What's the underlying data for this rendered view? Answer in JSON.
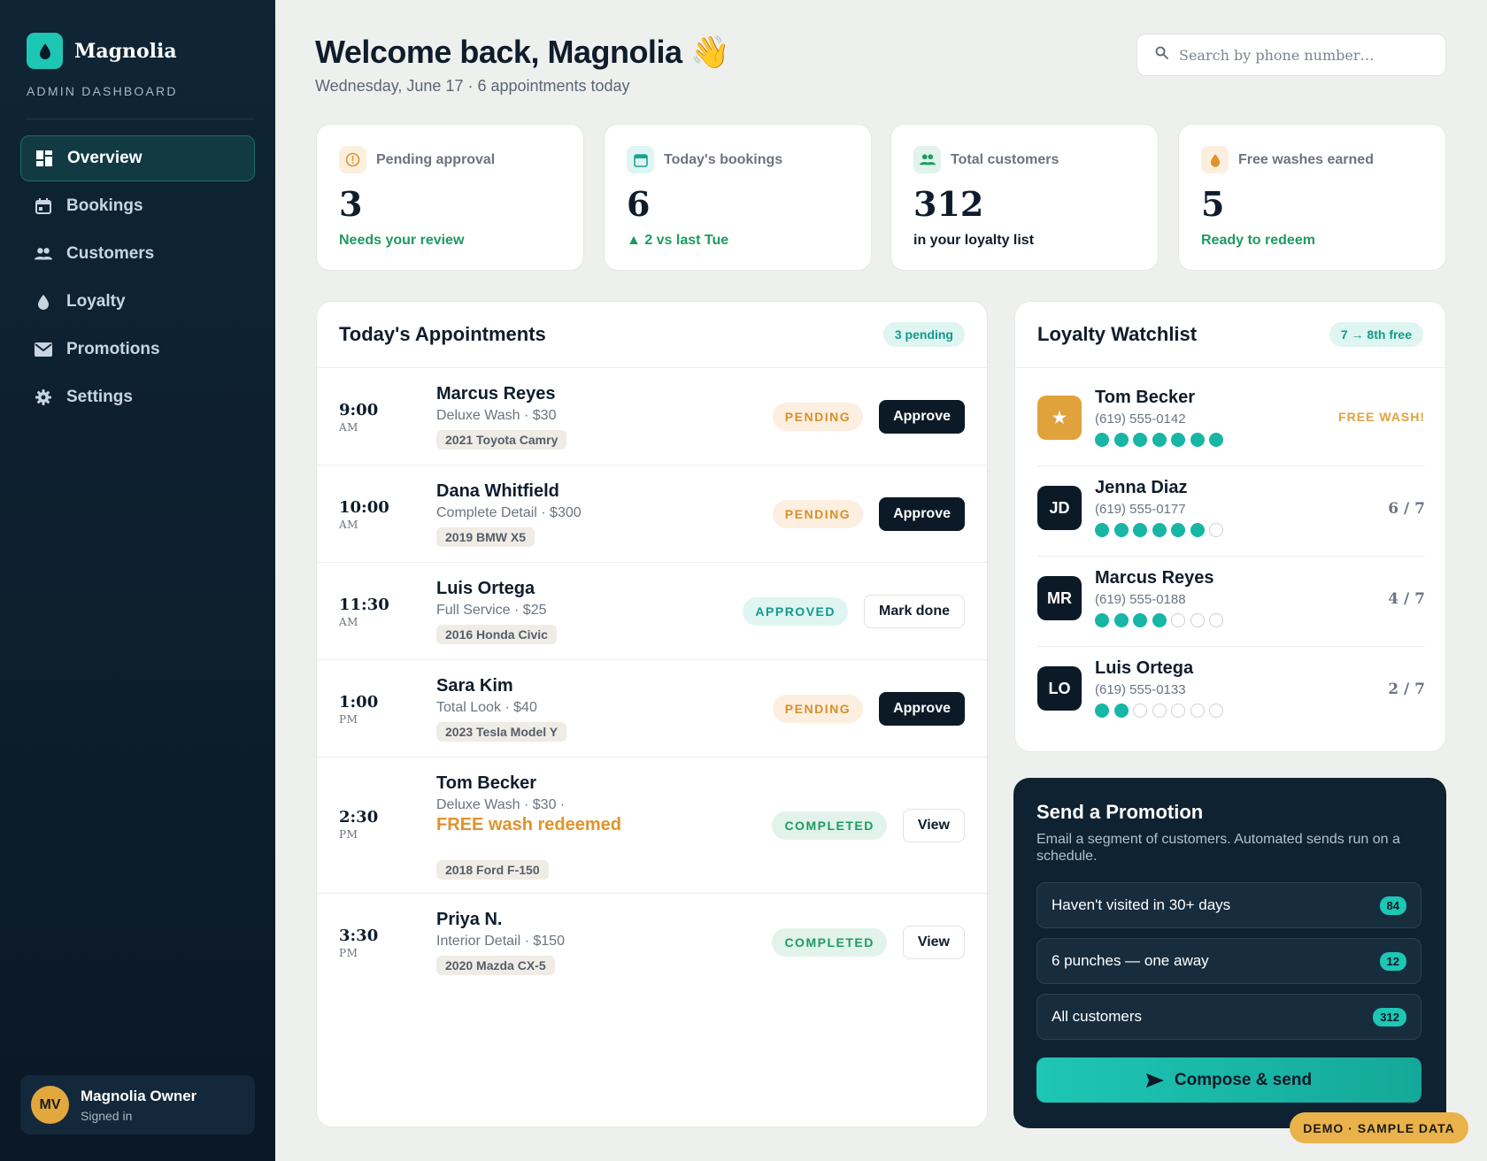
{
  "sidebar": {
    "brand": "Magnolia",
    "subtitle": "ADMIN DASHBOARD",
    "nav": [
      {
        "label": "Overview",
        "icon": "grid-icon",
        "active": true
      },
      {
        "label": "Bookings",
        "icon": "calendar-icon"
      },
      {
        "label": "Customers",
        "icon": "people-icon"
      },
      {
        "label": "Loyalty",
        "icon": "droplet-icon"
      },
      {
        "label": "Promotions",
        "icon": "mail-icon"
      },
      {
        "label": "Settings",
        "icon": "gear-icon"
      }
    ],
    "user": {
      "initials": "MV",
      "name": "Magnolia Owner",
      "status": "Signed in"
    }
  },
  "header": {
    "welcome": "Welcome back, Magnolia 👋",
    "subtitle": "Wednesday, June 17 · 6 appointments today",
    "search_placeholder": "Search by phone number…"
  },
  "stats": [
    {
      "label": "Pending approval",
      "value": "3",
      "note": "Needs your review",
      "icon": "alert-icon",
      "accent": "#e0932a"
    },
    {
      "label": "Today's bookings",
      "value": "6",
      "note": "▲ 2 vs last Tue",
      "icon": "calendar-icon",
      "accent": "#17a595"
    },
    {
      "label": "Total customers",
      "value": "312",
      "note": "in your loyalty list",
      "icon": "people-icon",
      "accent": "#1e9a62"
    },
    {
      "label": "Free washes earned",
      "value": "5",
      "note": "Ready to redeem",
      "icon": "droplet-icon",
      "accent": "#e0932a"
    }
  ],
  "appointments": {
    "title": "Today's Appointments",
    "badge": "3 pending",
    "rows": [
      {
        "time": "9:00",
        "ampm": "AM",
        "name": "Marcus Reyes",
        "service": "Deluxe Wash · $30",
        "car": "2021 Toyota Camry",
        "status": "PENDING",
        "action": "Approve"
      },
      {
        "time": "10:00",
        "ampm": "AM",
        "name": "Dana Whitfield",
        "service": "Complete Detail · $300",
        "car": "2019 BMW X5",
        "status": "PENDING",
        "action": "Approve"
      },
      {
        "time": "11:30",
        "ampm": "AM",
        "name": "Luis Ortega",
        "service": "Full Service · $25",
        "car": "2016 Honda Civic",
        "status": "APPROVED",
        "action": "Mark done"
      },
      {
        "time": "1:00",
        "ampm": "PM",
        "name": "Sara Kim",
        "service": "Total Look · $40",
        "car": "2023 Tesla Model Y",
        "status": "PENDING",
        "action": "Approve"
      },
      {
        "time": "2:30",
        "ampm": "PM",
        "name": "Tom Becker",
        "service": "Deluxe Wash · $30 ·",
        "free": "FREE wash redeemed",
        "car": "2018 Ford F-150",
        "status": "COMPLETED",
        "action": "View"
      },
      {
        "time": "3:30",
        "ampm": "PM",
        "name": "Priya N.",
        "service": "Interior Detail · $150",
        "car": "2020 Mazda CX-5",
        "status": "COMPLETED",
        "action": "View"
      }
    ]
  },
  "loyalty": {
    "title": "Loyalty Watchlist",
    "badge": "7 → 8th free",
    "rows": [
      {
        "initials": "★",
        "name": "Tom Becker",
        "phone": "(619) 555-0142",
        "punches": 7,
        "right": "FREE WASH!"
      },
      {
        "initials": "JD",
        "name": "Jenna Diaz",
        "phone": "(619) 555-0177",
        "punches": 6,
        "right": "6 / 7"
      },
      {
        "initials": "MR",
        "name": "Marcus Reyes",
        "phone": "(619) 555-0188",
        "punches": 4,
        "right": "4 / 7"
      },
      {
        "initials": "LO",
        "name": "Luis Ortega",
        "phone": "(619) 555-0133",
        "punches": 2,
        "right": "2 / 7"
      }
    ]
  },
  "promotion": {
    "title": "Send a Promotion",
    "desc": "Email a segment of customers. Automated sends run on a schedule.",
    "segments": [
      {
        "label": "Haven't visited in 30+ days",
        "count": "84"
      },
      {
        "label": "6 punches — one away",
        "count": "12"
      },
      {
        "label": "All customers",
        "count": "312"
      }
    ],
    "button": "Compose & send"
  },
  "demo_badge": "DEMO · SAMPLE DATA"
}
